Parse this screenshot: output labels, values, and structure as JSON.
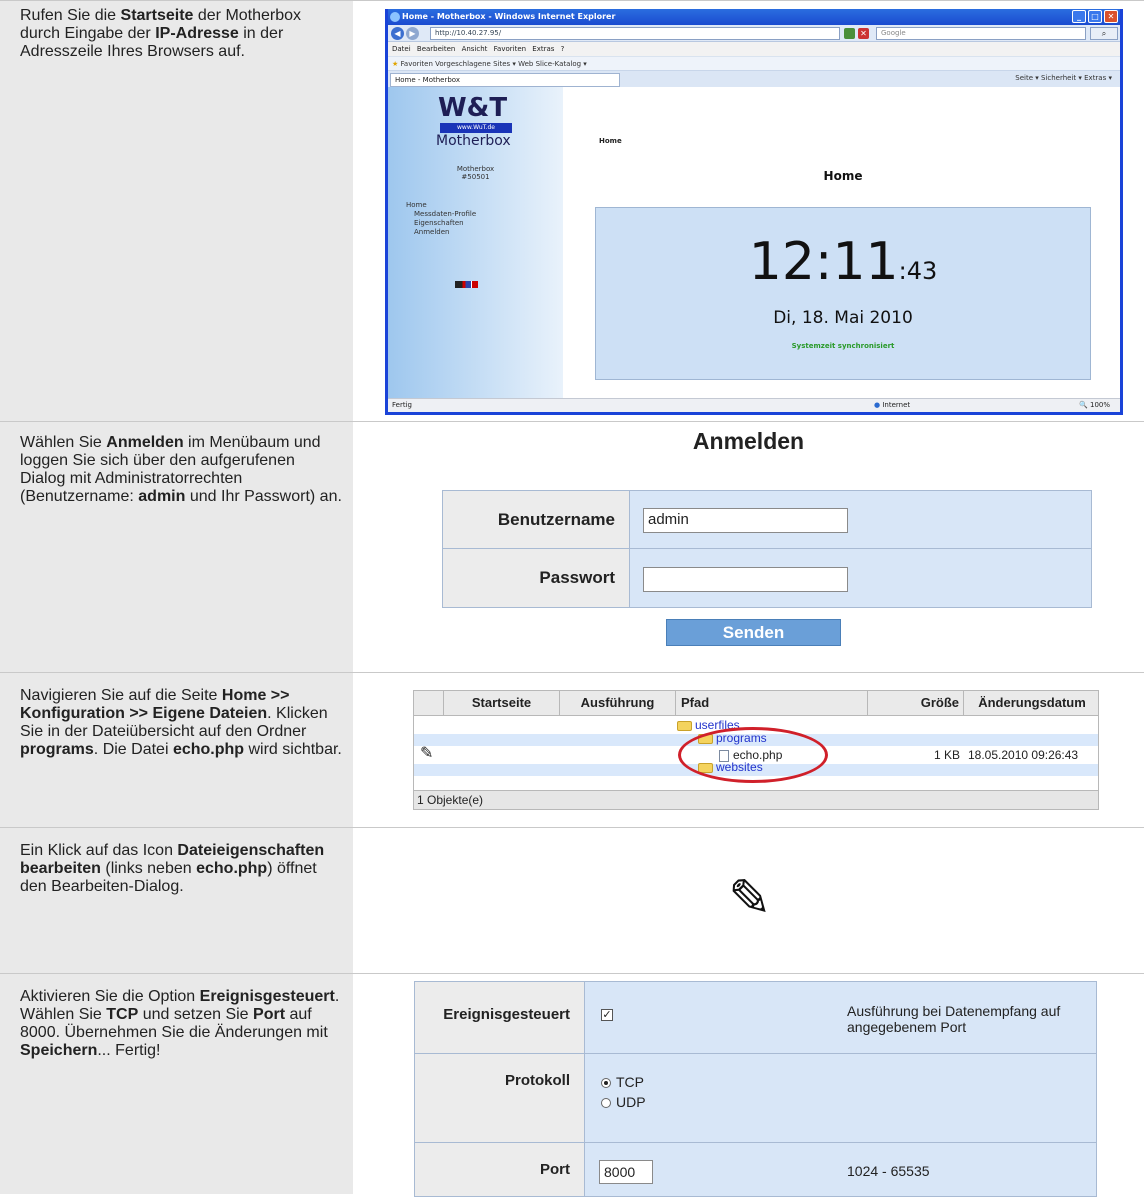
{
  "steps": [
    {
      "parts": [
        {
          "t": "Rufen Sie die "
        },
        {
          "t": "Startseite",
          "b": true
        },
        {
          "t": " der Motherbox durch Eingabe der "
        },
        {
          "t": "IP-Adresse",
          "b": true
        },
        {
          "t": " in der Adresszeile Ihres Browsers auf."
        }
      ]
    },
    {
      "parts": [
        {
          "t": "Wählen Sie "
        },
        {
          "t": "Anmelden",
          "b": true
        },
        {
          "t": " im Menübaum und loggen Sie sich über den aufgerufenen Dialog mit Administratorrechten (Benutzername: "
        },
        {
          "t": "admin",
          "b": true
        },
        {
          "t": " und Ihr Passwort) an."
        }
      ]
    },
    {
      "parts": [
        {
          "t": "Navigieren Sie auf die Seite "
        },
        {
          "t": "Home >> Konfiguration >> Eigene Dateien",
          "b": true
        },
        {
          "t": ". Klicken Sie in der Dateiübersicht auf den Ordner "
        },
        {
          "t": "programs",
          "b": true
        },
        {
          "t": ". Die Datei "
        },
        {
          "t": "echo.php",
          "b": true
        },
        {
          "t": " wird sichtbar."
        }
      ]
    },
    {
      "parts": [
        {
          "t": "Ein Klick auf das Icon "
        },
        {
          "t": "Dateieigenschaften bearbeiten",
          "b": true
        },
        {
          "t": " (links neben "
        },
        {
          "t": "echo.php",
          "b": true
        },
        {
          "t": ") öffnet den Bearbeiten-Dialog."
        }
      ]
    },
    {
      "parts": [
        {
          "t": "Aktivieren Sie die Option "
        },
        {
          "t": "Ereignisgesteuert",
          "b": true
        },
        {
          "t": ". Wählen Sie "
        },
        {
          "t": "TCP",
          "b": true
        },
        {
          "t": " und setzen Sie "
        },
        {
          "t": "Port",
          "b": true
        },
        {
          "t": " auf 8000. Übernehmen Sie die Änderungen mit "
        },
        {
          "t": "Speichern",
          "b": true
        },
        {
          "t": "... Fertig!"
        }
      ]
    }
  ],
  "browser": {
    "title": "Home - Motherbox - Windows Internet Explorer",
    "address": "http://10.40.27.95/",
    "search_placeholder": "Google",
    "menu": "Datei Bearbeiten Ansicht Favoriten Extras ?",
    "favorites": "Favoriten   Vorgeschlagene Sites ▾   Web Slice-Katalog ▾",
    "tab_title": "Home - Motherbox",
    "tools": "Seite ▾  Sicherheit ▾  Extras ▾",
    "status_left": "Fertig",
    "status_zone": "Internet",
    "status_zoom": "100%"
  },
  "motherbox": {
    "logo": "W&T",
    "url": "www.WuT.de",
    "name": "Motherbox",
    "device_line1": "Motherbox",
    "device_line2": "#50501",
    "tree": [
      "Home",
      "Messdaten-Profile",
      "Eigenschaften",
      "Anmelden"
    ],
    "breadcrumb": "Home",
    "page_title": "Home",
    "time_main": "12:11",
    "time_sec": ":43",
    "date": "Di, 18. Mai 2010",
    "sync": "Systemzeit synchronisiert"
  },
  "login": {
    "title": "Anmelden",
    "user_label": "Benutzername",
    "user_value": "admin",
    "pass_label": "Passwort",
    "pass_value": "",
    "submit": "Senden"
  },
  "files": {
    "headers": [
      "Startseite",
      "Ausführung",
      "Pfad",
      "Größe",
      "Änderungsdatum"
    ],
    "folder_root": "userfiles",
    "folder_programs": "programs",
    "file_name": "echo.php",
    "file_size": "1 KB",
    "file_date": "18.05.2010 09:26:43",
    "folder_websites": "websites",
    "footer": "1 Objekte(e)"
  },
  "options": {
    "event_label": "Ereignisgesteuert",
    "event_checked": true,
    "event_desc": "Ausführung bei Datenempfang auf angegebenem Port",
    "proto_label": "Protokoll",
    "proto_options": [
      "TCP",
      "UDP"
    ],
    "proto_selected": "TCP",
    "port_label": "Port",
    "port_value": "8000",
    "port_range": "1024 - 65535"
  },
  "colors": {
    "ie_frame": "#1a43d8",
    "clock_bg": "#cde0f5",
    "sync_green": "#2a9a2a",
    "highlight_red": "#d0202a",
    "link_blue": "#2233cc"
  }
}
